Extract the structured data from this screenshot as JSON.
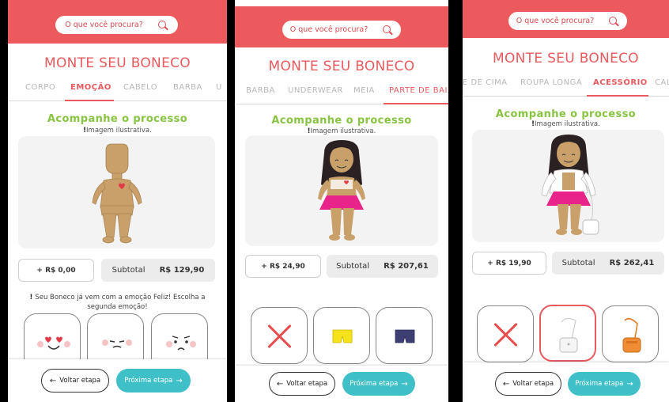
{
  "search": {
    "placeholder": "O que você procura?"
  },
  "title": "MONTE SEU BONECO",
  "process_title": "Acompanhe o processo",
  "illustrative": "Imagem ilustrativa.",
  "subtotal_label": "Subtotal",
  "back_label": "Voltar etapa",
  "next_label": "Próxima etapa",
  "colors": {
    "accent": "#ec5a5d",
    "green": "#86c441",
    "teal": "#3fc0c8"
  },
  "screens": [
    {
      "tabs": [
        "CORPO",
        "EMOÇÃO",
        "CABELO",
        "BARBA",
        "U"
      ],
      "active_tab": "EMOÇÃO",
      "price": "+ R$ 0,00",
      "subtotal": "R$ 129,90",
      "note": "Seu Boneco já vem com a emoção Feliz! Escolha a segunda emoção!",
      "options": [
        "emotion-love",
        "emotion-sleepy",
        "emotion-worried"
      ]
    },
    {
      "tabs": [
        "BARBA",
        "UNDERWEAR",
        "MEIA",
        "PARTE DE BAIX"
      ],
      "active_tab": "PARTE DE BAIX",
      "price": "+ R$ 24,90",
      "subtotal": "R$ 207,61",
      "options": [
        "none",
        "yellow-shorts",
        "navy-shorts"
      ]
    },
    {
      "tabs": [
        "E DE CIMA",
        "ROUPA LONGA",
        "ACESSÓRIO",
        "CAL"
      ],
      "active_tab": "ACESSÓRIO",
      "price": "+ R$ 19,90",
      "subtotal": "R$ 262,41",
      "options": [
        "none",
        "white-bag",
        "orange-bag"
      ],
      "selected_option": "white-bag"
    }
  ]
}
